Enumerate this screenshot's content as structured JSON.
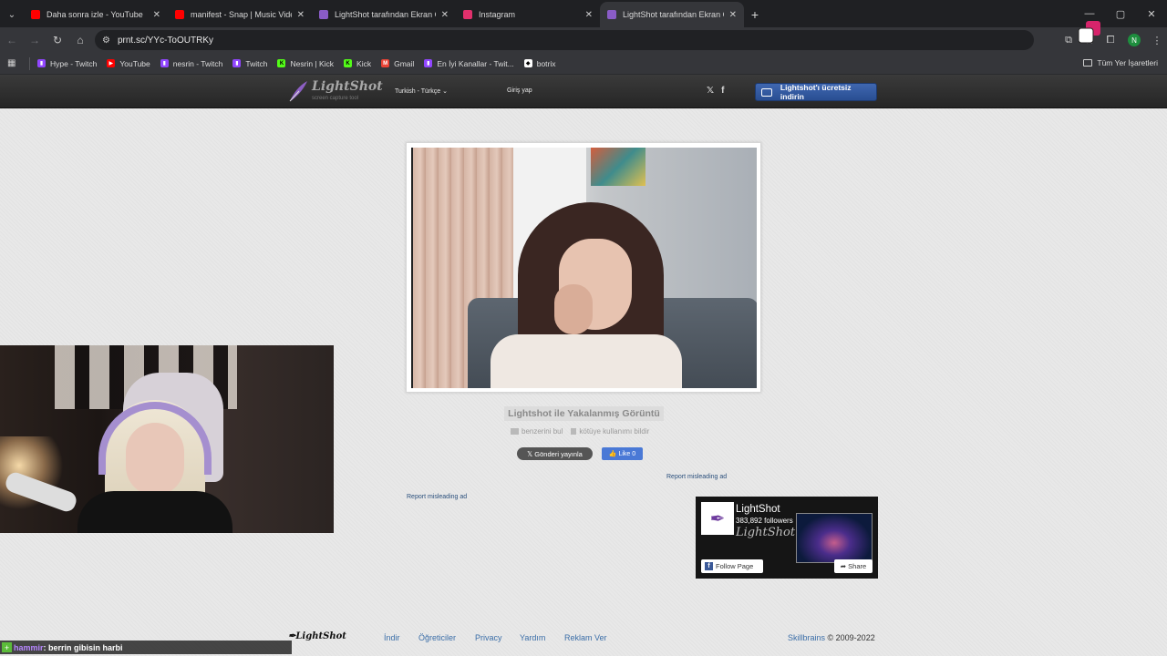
{
  "browser": {
    "tabs": [
      {
        "title": "Daha sonra izle - YouTube",
        "favicon_color": "#ff0000",
        "active": false
      },
      {
        "title": "manifest - Snap | Music Video",
        "favicon_color": "#ff0000",
        "active": false
      },
      {
        "title": "LightShot tarafından Ekran Görü",
        "favicon_color": "#8a5cc7",
        "active": false
      },
      {
        "title": "Instagram",
        "favicon_color": "#e1306c",
        "active": false
      },
      {
        "title": "LightShot tarafından Ekran Görü",
        "favicon_color": "#8a5cc7",
        "active": true
      }
    ],
    "url": "prnt.sc/YYc-ToOUTRKy",
    "profile_initial": "N",
    "bookmarks": [
      {
        "label": "Hype - Twitch",
        "color": "#9146ff",
        "icon": "twitch-icon"
      },
      {
        "label": "YouTube",
        "color": "#ff0000",
        "icon": "youtube-icon"
      },
      {
        "label": "nesrin - Twitch",
        "color": "#9146ff",
        "icon": "twitch-icon"
      },
      {
        "label": "Twitch",
        "color": "#9146ff",
        "icon": "twitch-icon"
      },
      {
        "label": "Nesrin | Kick",
        "color": "#53fc18",
        "icon": "kick-icon"
      },
      {
        "label": "Kick",
        "color": "#53fc18",
        "icon": "kick-icon"
      },
      {
        "label": "Gmail",
        "color": "#ea4335",
        "icon": "gmail-icon"
      },
      {
        "label": "En İyi Kanallar - Twit...",
        "color": "#9146ff",
        "icon": "twitch-icon"
      },
      {
        "label": "botrix",
        "color": "#ffffff",
        "icon": "botrix-icon"
      }
    ],
    "all_bookmarks_label": "Tüm Yer İşaretleri"
  },
  "lightshot": {
    "logo_text": "LightShot",
    "logo_sub": "screen capture tool",
    "language": "Turkish - Türkçe",
    "login": "Giriş yap",
    "download_label": "Lightshot'ı ücretsiz indirin",
    "caption": "Lightshot ile Yakalanmış Görüntü",
    "find_similar": "benzerini bul",
    "report_abuse": "kötüye kullanımı bildir",
    "tweet_label": "Gönderi yayınla",
    "like_label": "Like 0",
    "report_ad": "Report misleading ad",
    "fb_page_name": "LightShot",
    "fb_followers": "383,892 followers",
    "fb_sub": "LightShot",
    "fb_follow": "Follow Page",
    "fb_share": "Share"
  },
  "footer": {
    "logo": "LightShot",
    "links": [
      "İndir",
      "Öğreticiler",
      "Privacy",
      "Yardım",
      "Reklam Ver"
    ],
    "company": "Skillbrains",
    "copyright": "© 2009-2022"
  },
  "chat": {
    "user": "hammir",
    "message": ": berrin gibisin harbi"
  }
}
